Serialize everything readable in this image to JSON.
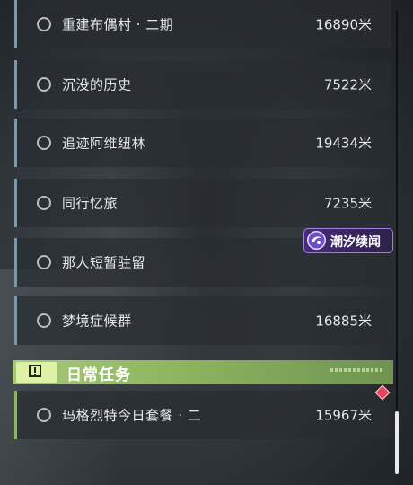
{
  "quests": [
    {
      "name": "重建布偶村 · 二期",
      "distance": "16890米"
    },
    {
      "name": "沉没的历史",
      "distance": "7522米"
    },
    {
      "name": "追迹阿维纽林",
      "distance": "19434米"
    },
    {
      "name": "同行忆旅",
      "distance": "7235米"
    },
    {
      "name": "那人短暂驻留",
      "distance": ""
    },
    {
      "name": "梦境症候群",
      "distance": "16885米"
    }
  ],
  "daily_section": {
    "title": "日常任务",
    "icon": "exclamation-box-icon"
  },
  "daily_quests": [
    {
      "name": "玛格烈特今日套餐 · 二",
      "distance": "15967米"
    }
  ],
  "badge": {
    "label": "潮汐续闻",
    "icon": "tide-swirl-icon"
  },
  "colors": {
    "row_bg": "#2d3237",
    "row_accent": "#7f98a6",
    "daily_accent": "#8fb36a",
    "header_green": "#8db460",
    "badge_purple": "#4a2a7a",
    "marker_red": "#e24a5c"
  }
}
